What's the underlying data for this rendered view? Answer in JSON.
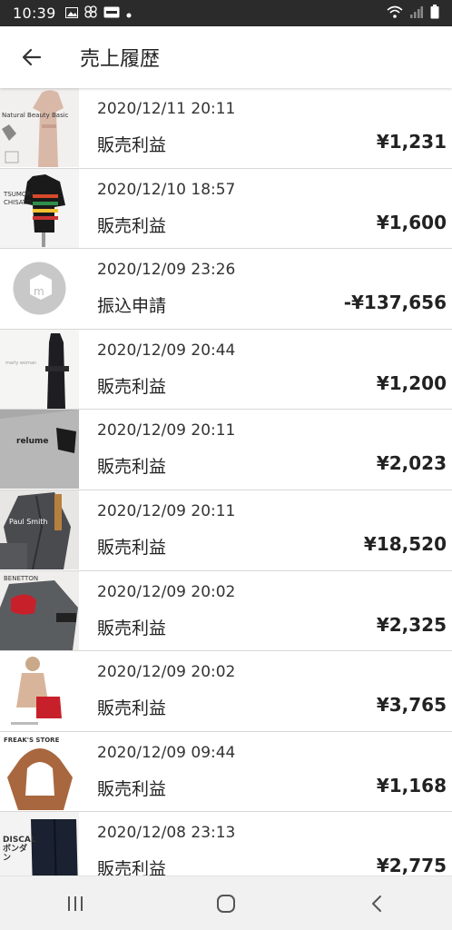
{
  "status_bar": {
    "time": "10:39"
  },
  "header": {
    "title": "売上履歴"
  },
  "entries": [
    {
      "date": "2020/12/11 20:11",
      "type": "販売利益",
      "amount": "¥1,231",
      "thumb_label": "Natural Beauty Basic"
    },
    {
      "date": "2020/12/10 18:57",
      "type": "販売利益",
      "amount": "¥1,600",
      "thumb_label": "TSUMORI CHISATO"
    },
    {
      "date": "2020/12/09 23:26",
      "type": "振込申請",
      "amount": "-¥137,656",
      "thumb_label": "m"
    },
    {
      "date": "2020/12/09 20:44",
      "type": "販売利益",
      "amount": "¥1,200",
      "thumb_label": "marly woman"
    },
    {
      "date": "2020/12/09 20:11",
      "type": "販売利益",
      "amount": "¥2,023",
      "thumb_label": "relume"
    },
    {
      "date": "2020/12/09 20:11",
      "type": "販売利益",
      "amount": "¥18,520",
      "thumb_label": "Paul Smith"
    },
    {
      "date": "2020/12/09 20:02",
      "type": "販売利益",
      "amount": "¥2,325",
      "thumb_label": "BENETTON"
    },
    {
      "date": "2020/12/09 20:02",
      "type": "販売利益",
      "amount": "¥3,765",
      "thumb_label": ""
    },
    {
      "date": "2020/12/09 09:44",
      "type": "販売利益",
      "amount": "¥1,168",
      "thumb_label": "FREAK'S STORE"
    },
    {
      "date": "2020/12/08 23:13",
      "type": "販売利益",
      "amount": "¥2,775",
      "thumb_label": "DISCAL ボンダン"
    }
  ],
  "colors": {
    "status_bar": "#2b2b2b",
    "divider": "#d7d7d7",
    "nav_bar": "#f1f1f1"
  }
}
